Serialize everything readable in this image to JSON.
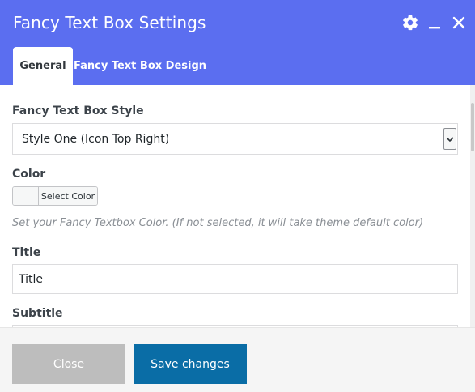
{
  "header": {
    "title": "Fancy Text Box Settings",
    "icons": [
      "gear-icon",
      "minimize-icon",
      "close-icon"
    ],
    "color": "#5b6ef0"
  },
  "tabs": [
    {
      "label": "General",
      "active": true
    },
    {
      "label": "Fancy Text Box Design",
      "active": false
    }
  ],
  "fields": {
    "style": {
      "label": "Fancy Text Box Style",
      "selected": "Style One (Icon Top Right)"
    },
    "color": {
      "label": "Color",
      "button_label": "Select Color",
      "hint": "Set your Fancy Textbox Color. (If not selected, it will take theme default color)"
    },
    "title": {
      "label": "Title",
      "value": "Title"
    },
    "subtitle": {
      "label": "Subtitle",
      "value": ""
    }
  },
  "footer": {
    "close_label": "Close",
    "save_label": "Save changes",
    "save_color": "#0a6da6"
  }
}
